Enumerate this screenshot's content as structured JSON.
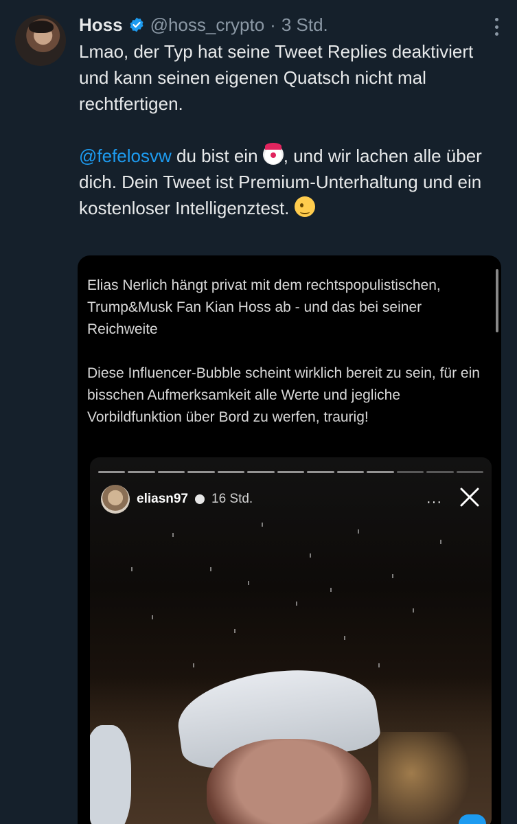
{
  "author": {
    "name": "Hoss",
    "handle": "@hoss_crypto",
    "separator": "·",
    "time": "3 Std."
  },
  "tweet": {
    "paragraph1": "Lmao, der Typ hat seine Tweet Replies deaktiviert und kann seinen eigenen Quatsch nicht mal rechtfertigen.",
    "mention": "@fefelosvw",
    "p2_part1": " du bist ein ",
    "p2_part2": ", und wir lachen alle über dich. Dein Tweet ist Premium-Unterhaltung und ein kostenloser Intelligenztest. ",
    "emoji1": "clown-emoji",
    "emoji2": "winking-face-emoji"
  },
  "media": {
    "text1": "Elias Nerlich hängt privat mit dem rechtspopulistischen, Trump&Musk Fan Kian Hoss ab - und das bei seiner Reichweite",
    "text2": "Diese Influencer-Bubble scheint wirklich bereit zu sein, für ein bisschen Aufmerksamkeit alle Werte und jegliche Vorbildfunktion über Bord zu werfen, traurig!",
    "story": {
      "username": "eliasn97",
      "time": "16 Std.",
      "more": "···",
      "segments": 13,
      "active_segment": 10
    }
  },
  "colors": {
    "background": "#15202b",
    "mention": "#1d9bf0",
    "verified": "#1d9bf0",
    "muted": "#8b98a5"
  }
}
